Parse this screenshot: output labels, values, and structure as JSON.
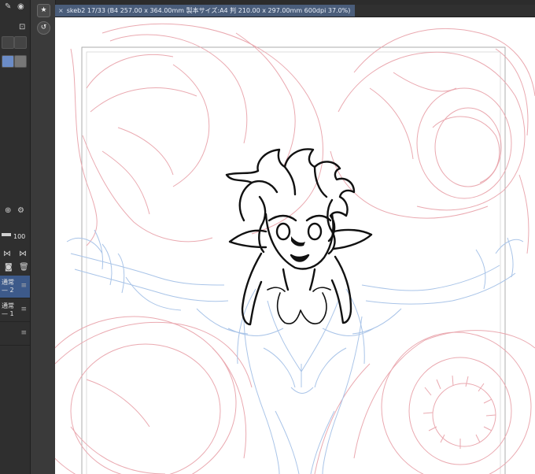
{
  "document_tab": {
    "close_glyph": "×",
    "title": "skeb2 17/33 (B4 257.00 x 364.00mm 製本サイズ:A4 判 210.00 x 297.00mm 600dpi 37.0%)"
  },
  "layer_panel": {
    "opacity_value": "100",
    "layers": [
      {
        "name": "通常",
        "mode": "— 2",
        "selected": true
      },
      {
        "name": "通常",
        "mode": "— 1",
        "selected": false
      }
    ]
  },
  "tool_strip": {
    "icons": [
      "star-icon",
      "rotate-view-icon"
    ],
    "star_glyph": "★",
    "rotate_glyph": "↺"
  },
  "colors": {
    "selected_layer": "#3d5a8a",
    "sketch_red": "#e8a0a8",
    "sketch_blue": "#a9c4e8",
    "lineart": "#111111"
  }
}
